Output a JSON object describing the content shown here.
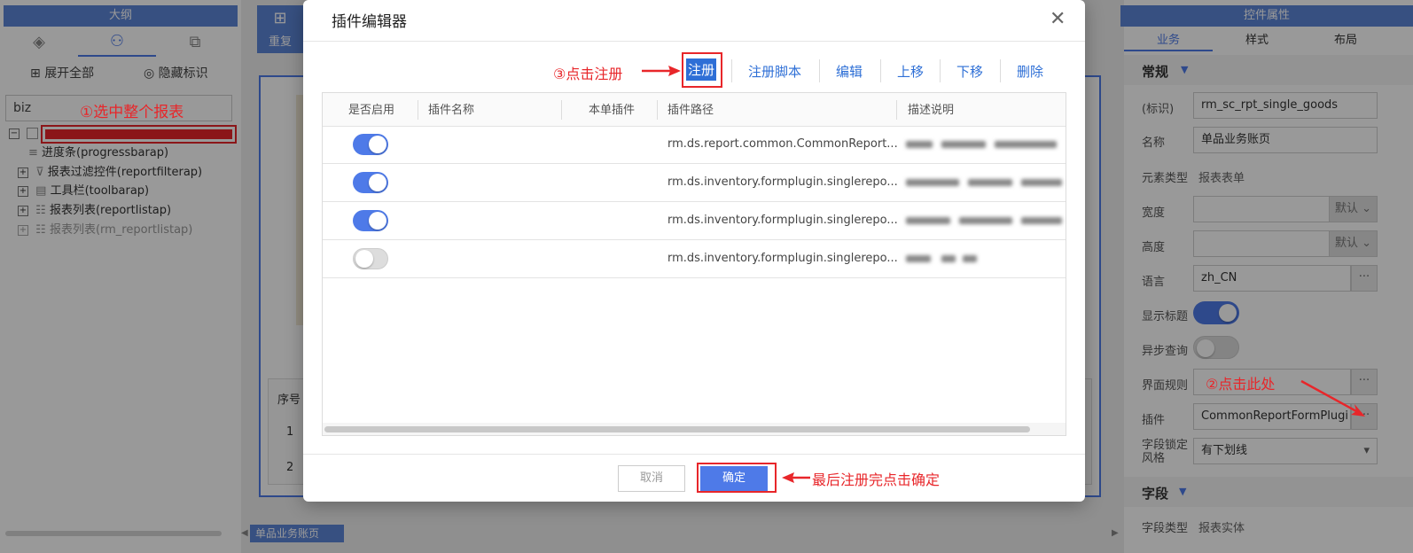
{
  "left_panel": {
    "title": "大纲",
    "expand_all": "展开全部",
    "hide_marks": "隐藏标识",
    "search_value": "biz",
    "tree": [
      {
        "label": "进度条(progressbarap)"
      },
      {
        "label": "报表过滤控件(reportfilterap)"
      },
      {
        "label": "工具栏(toolbarap)"
      },
      {
        "label": "报表列表(reportlistap)"
      },
      {
        "label": "报表列表(rm_reportlistap)"
      }
    ]
  },
  "center": {
    "toolbar_item": "重复",
    "grid_header_seq": "序号",
    "grid_rows": [
      "1",
      "2"
    ],
    "bottom_tab": "单品业务账页"
  },
  "right_panel": {
    "title": "控件属性",
    "tabs": [
      "业务",
      "样式",
      "布局"
    ],
    "section_general": "常规",
    "section_field": "字段",
    "props": {
      "id_label": "(标识)",
      "id_value": "rm_sc_rpt_single_goods",
      "name_label": "名称",
      "name_value": "单品业务账页",
      "type_label": "元素类型",
      "type_value": "报表表单",
      "width_label": "宽度",
      "width_default": "默认",
      "height_label": "高度",
      "height_default": "默认",
      "lang_label": "语言",
      "lang_value": "zh_CN",
      "show_title_label": "显示标题",
      "async_label": "异步查询",
      "ui_rule_label": "界面规则",
      "plugin_label": "插件",
      "plugin_value": "CommonReportFormPlugi",
      "lock_style_label": "字段锁定风格",
      "lock_style_value": "有下划线",
      "field_type_label": "字段类型",
      "field_type_value": "报表实体"
    }
  },
  "dialog": {
    "title": "插件编辑器",
    "toolbar": [
      "注册",
      "注册脚本",
      "编辑",
      "上移",
      "下移",
      "删除"
    ],
    "columns": [
      "是否启用",
      "插件名称",
      "本单插件",
      "插件路径",
      "描述说明"
    ],
    "rows": [
      {
        "enabled": true,
        "path": "rm.ds.report.common.CommonReport..."
      },
      {
        "enabled": true,
        "path": "rm.ds.inventory.formplugin.singlerepo..."
      },
      {
        "enabled": true,
        "path": "rm.ds.inventory.formplugin.singlerepo..."
      },
      {
        "enabled": false,
        "path": "rm.ds.inventory.formplugin.singlerepo..."
      }
    ],
    "cancel_label": "取消",
    "ok_label": "确定"
  },
  "annotations": {
    "step1": "①选中整个报表",
    "step2": "②点击此处",
    "step3": "③点击注册",
    "final": "最后注册完点击确定"
  },
  "colors": {
    "accent": "#4e7ae8",
    "panel_header": "#5d85d7",
    "annotation": "#e8262a"
  }
}
